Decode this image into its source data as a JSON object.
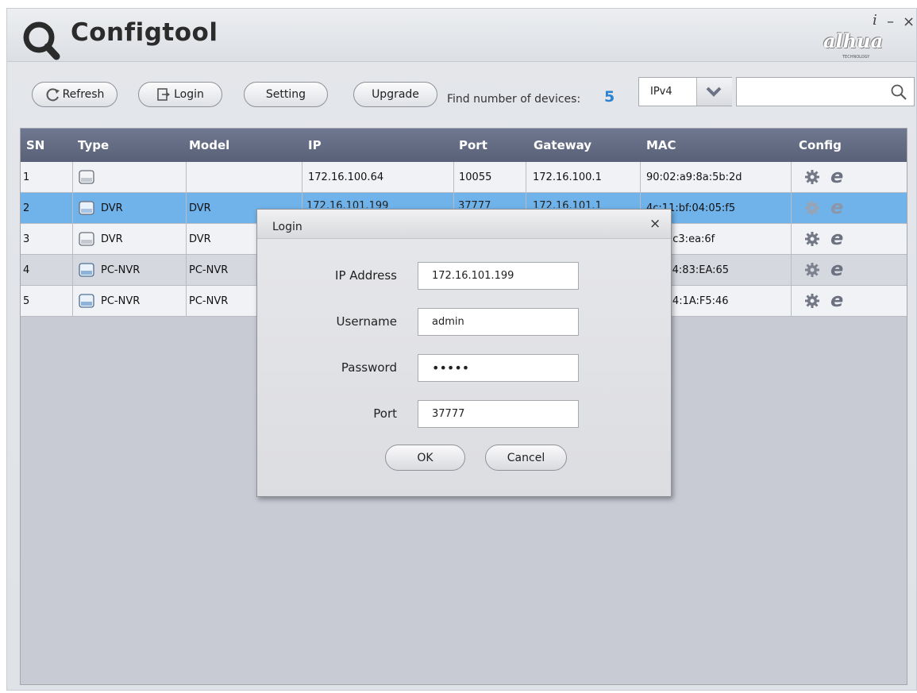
{
  "app": {
    "title": "Configtool",
    "brand": "alhua",
    "brand_sub": "TECHNOLOGY"
  },
  "window_controls": {
    "info": "i",
    "minimize": "–",
    "close": "×"
  },
  "toolbar": {
    "refresh_label": "Refresh",
    "login_label": "Login",
    "setting_label": "Setting",
    "upgrade_label": "Upgrade",
    "find_label": "Find number of devices:",
    "find_count": "5",
    "ip_mode": "IPv4",
    "search_value": ""
  },
  "table": {
    "columns": [
      "SN",
      "Type",
      "Model",
      "IP",
      "Port",
      "Gateway",
      "MAC",
      "Config"
    ],
    "rows": [
      {
        "sn": "1",
        "type": "",
        "model": "",
        "ip": "172.16.100.64",
        "port": "10055",
        "gateway": "172.16.100.1",
        "mac": "90:02:a9:8a:5b:2d"
      },
      {
        "sn": "2",
        "type": "DVR",
        "model": "DVR",
        "ip": "",
        "port": "",
        "gateway": "",
        "mac": "4c:11:bf:04:05:f5"
      },
      {
        "sn": "3",
        "type": "DVR",
        "model": "DVR",
        "ip": "",
        "port": "",
        "gateway": "",
        "mac": "2:a9:c3:ea:6f"
      },
      {
        "sn": "4",
        "type": "PC-NVR",
        "model": "PC-NVR",
        "ip": "",
        "port": "",
        "gateway": "",
        "mac": "D:04:83:EA:65"
      },
      {
        "sn": "5",
        "type": "PC-NVR",
        "model": "PC-NVR",
        "ip": "",
        "port": "",
        "gateway": "",
        "mac": "2:24:1A:F5:46"
      }
    ],
    "selected_row": 2
  },
  "login_dialog": {
    "title": "Login",
    "close": "×",
    "ip_label": "IP Address",
    "ip_value": "172.16.101.199",
    "username_label": "Username",
    "username_value": "admin",
    "password_label": "Password",
    "password_value": "admin",
    "port_label": "Port",
    "port_value": "37777",
    "ok_label": "OK",
    "cancel_label": "Cancel"
  },
  "colors": {
    "accent": "#2a83d2",
    "header_bg": "#616a82",
    "selected_row": "#6fb3ea"
  },
  "icons": [
    "search-icon",
    "refresh-icon",
    "login-icon",
    "chevron-down-icon",
    "device-icon",
    "gear-icon",
    "ie-icon",
    "close-icon",
    "info-icon",
    "minimize-icon"
  ]
}
